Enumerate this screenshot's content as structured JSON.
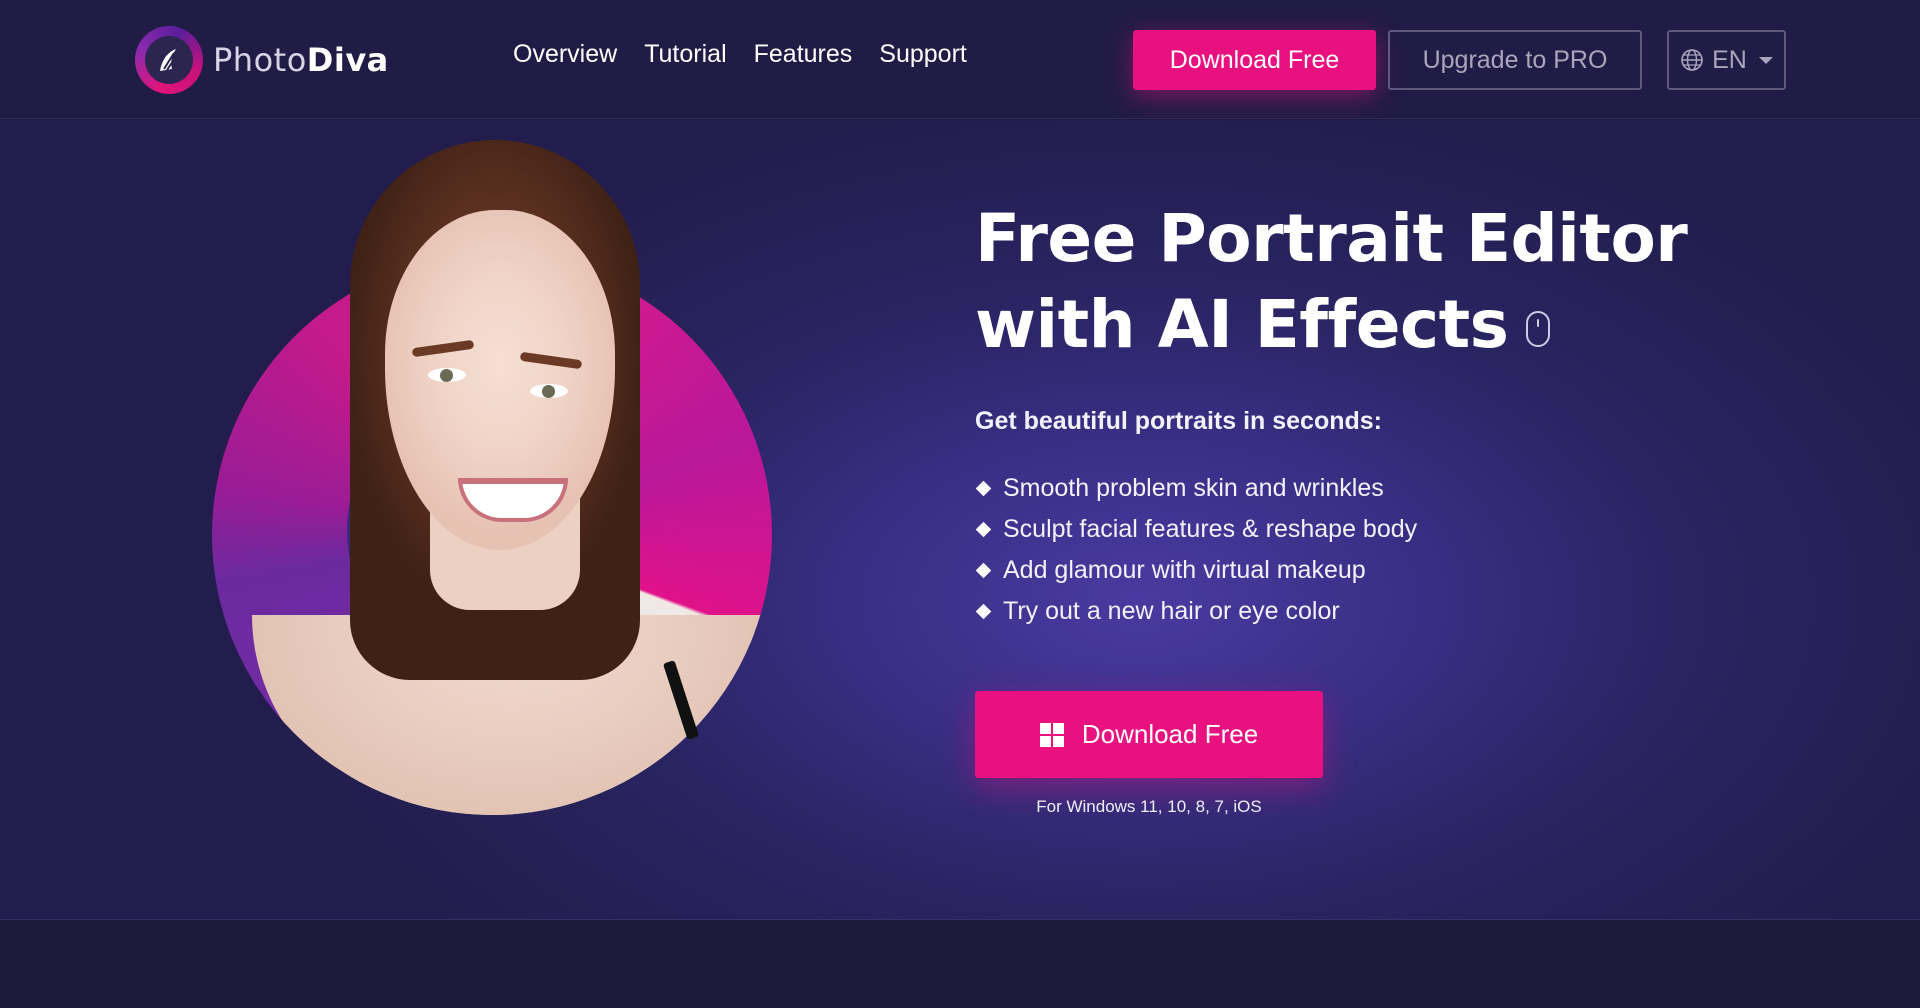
{
  "header": {
    "logo": {
      "name_light": "Photo",
      "name_bold": "Diva"
    },
    "nav": [
      {
        "label": "Overview"
      },
      {
        "label": "Tutorial"
      },
      {
        "label": "Features"
      },
      {
        "label": "Support"
      }
    ],
    "download_label": "Download Free",
    "upgrade_label": "Upgrade to PRO",
    "language": {
      "icon": "globe-icon",
      "value": "EN"
    }
  },
  "hero": {
    "title_line1": "Free Portrait Editor",
    "title_line2": "with AI Effects",
    "subtitle": "Get beautiful portraits in seconds:",
    "bullets": [
      "Smooth problem skin and wrinkles",
      "Sculpt facial features & reshape body",
      "Add glamour with virtual makeup",
      "Try out a new hair or eye color"
    ],
    "cta_label": "Download Free",
    "cta_icon": "windows-icon",
    "platforms": "For Windows 11, 10, 8, 7, iOS"
  },
  "colors": {
    "accent": "#e8117f",
    "background": "#221d4c",
    "header_bg": "#211c45"
  }
}
